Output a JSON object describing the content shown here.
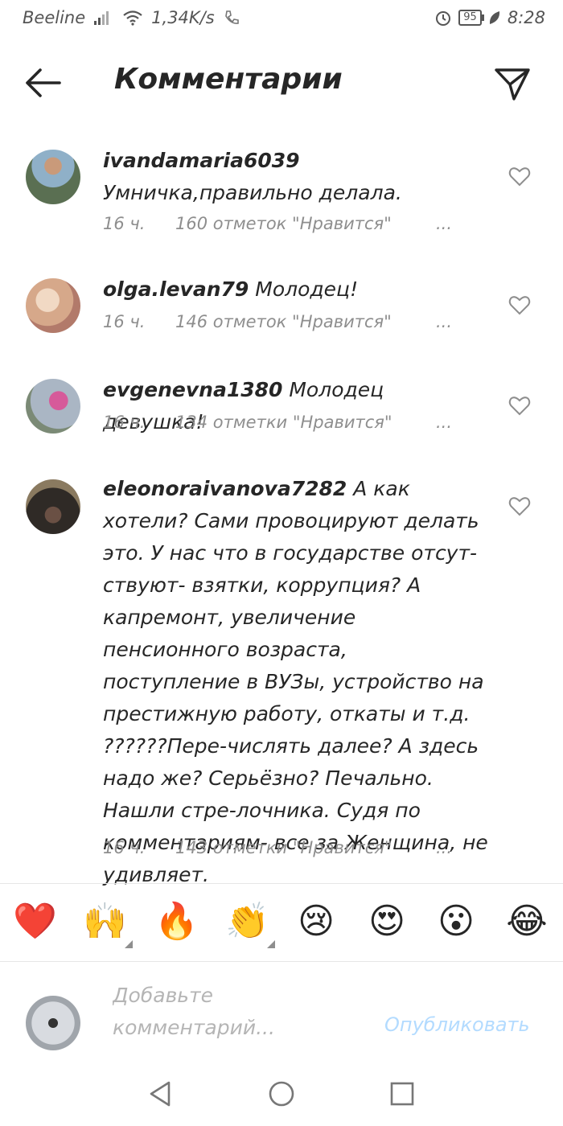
{
  "status_bar": {
    "carrier": "Beeline",
    "speed": "1,34K/s",
    "battery": "95",
    "time": "8:28"
  },
  "header": {
    "title": "Комментарии",
    "back_icon": "arrow-left-icon",
    "send_icon": "paper-plane-icon"
  },
  "comments": [
    {
      "username": "ivandamaria6039",
      "text": "Умничка,правильно делала.",
      "time": "16 ч.",
      "likes": "160 отметок \"Нравится\"",
      "more": "...",
      "avatar_color": "#7f9db5"
    },
    {
      "username": "olga.levan79",
      "text": "Молодец!",
      "time": "16 ч.",
      "likes": "146 отметок \"Нравится\"",
      "more": "...",
      "avatar_color": "#d8b8a0"
    },
    {
      "username": "evgenevna1380",
      "text": "Молодец девушка!",
      "time": "16 ч.",
      "likes": "134 отметки \"Нравится\"",
      "more": "...",
      "avatar_color": "#9aa7b8"
    },
    {
      "username": "eleonoraivanova7282",
      "text": "А как хотели? Сами провоцируют делать это. У нас что в государстве отсут-ствуют- взятки, коррупция? А капремонт, увеличение пенсионного возраста, поступление в ВУЗы, устройство на престижную работу, откаты и т.д. ??????Пере-числять далее? А здесь надо же? Серьёзно? Печально. Нашли стре-лочника. Судя по комментариям- все за Женщина, не удивляет.",
      "time": "16 ч.",
      "likes": "143 отметки \"Нравится\"",
      "more": "...",
      "avatar_color": "#4a4038"
    }
  ],
  "emoji_bar": [
    {
      "glyph": "❤️",
      "name": "red-heart-emoji"
    },
    {
      "glyph": "🙌",
      "name": "raised-hands-emoji"
    },
    {
      "glyph": "🔥",
      "name": "fire-emoji"
    },
    {
      "glyph": "👏",
      "name": "clapping-hands-emoji"
    },
    {
      "glyph": "😢",
      "name": "crying-face-emoji"
    },
    {
      "glyph": "😍",
      "name": "heart-eyes-emoji"
    },
    {
      "glyph": "😮",
      "name": "surprised-face-emoji"
    },
    {
      "glyph": "😂",
      "name": "tears-of-joy-emoji"
    }
  ],
  "composer": {
    "placeholder": "Добавьте комментарий...",
    "publish_label": "Опубликовать",
    "avatar_color": "#c8ccd2"
  },
  "nav_bar": {
    "back_icon": "triangle-back-icon",
    "home_icon": "circle-home-icon",
    "recents_icon": "square-recents-icon"
  },
  "colors": {
    "text": "#262626",
    "secondary": "#8e8e8e",
    "publish_disabled": "#b3dbff",
    "heart": "#e0245e"
  }
}
